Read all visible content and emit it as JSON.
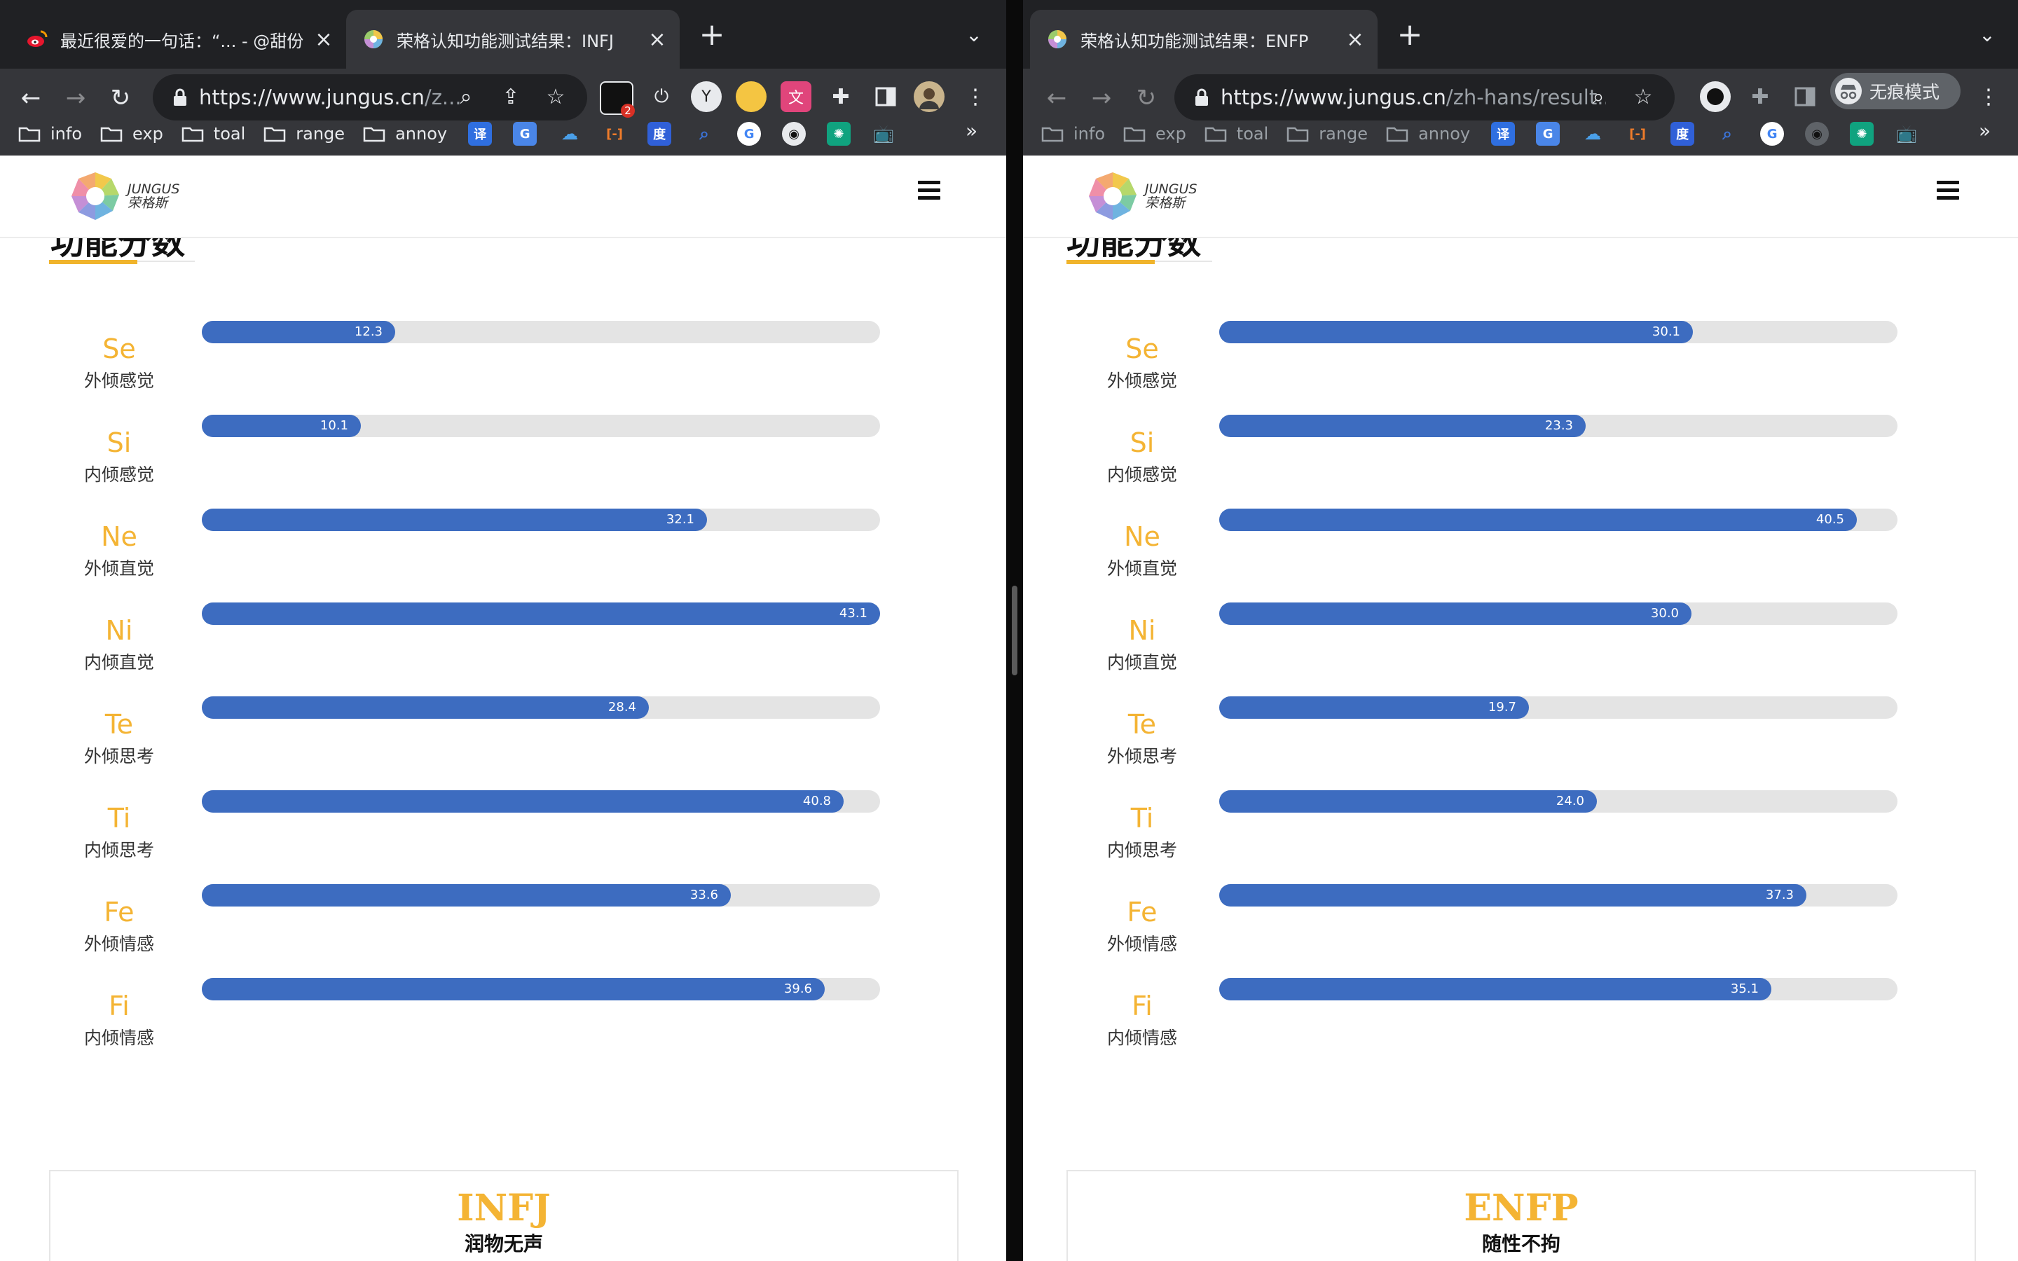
{
  "left": {
    "tabs": [
      {
        "title": "最近很爱的一句话：“... - @甜份",
        "active": false,
        "icon": "weibo-icon"
      },
      {
        "title": "荣格认知功能测试结果：INFJ",
        "active": true,
        "icon": "jungus-icon"
      }
    ],
    "url_host": "https://www.jungus.cn",
    "url_path": "/z...",
    "extension_badge": "2",
    "bookmarks": [
      "info",
      "exp",
      "toal",
      "range",
      "annoy"
    ],
    "logo": {
      "en": "JUNGUS",
      "zh": "荣格斯"
    },
    "section_title": "功能分数",
    "functions": [
      {
        "code": "Se",
        "name": "外倾感觉",
        "value": 12.3,
        "label": "12.3"
      },
      {
        "code": "Si",
        "name": "内倾感觉",
        "value": 10.1,
        "label": "10.1"
      },
      {
        "code": "Ne",
        "name": "外倾直觉",
        "value": 32.1,
        "label": "32.1"
      },
      {
        "code": "Ni",
        "name": "内倾直觉",
        "value": 43.1,
        "label": "43.1"
      },
      {
        "code": "Te",
        "name": "外倾思考",
        "value": 28.4,
        "label": "28.4"
      },
      {
        "code": "Ti",
        "name": "内倾思考",
        "value": 40.8,
        "label": "40.8"
      },
      {
        "code": "Fe",
        "name": "外倾情感",
        "value": 33.6,
        "label": "33.6"
      },
      {
        "code": "Fi",
        "name": "内倾情感",
        "value": 39.6,
        "label": "39.6"
      }
    ],
    "type_code": "INFJ",
    "type_name": "润物无声"
  },
  "right": {
    "tabs": [
      {
        "title": "荣格认知功能测试结果：ENFP",
        "active": true,
        "icon": "jungus-icon"
      }
    ],
    "url_host": "https://www.jungus.cn",
    "url_path": "/zh-hans/result...",
    "incognito_label": "无痕模式",
    "bookmarks": [
      "info",
      "exp",
      "toal",
      "range",
      "annoy"
    ],
    "logo": {
      "en": "JUNGUS",
      "zh": "荣格斯"
    },
    "section_title": "功能分数",
    "functions": [
      {
        "code": "Se",
        "name": "外倾感觉",
        "value": 30.1,
        "label": "30.1"
      },
      {
        "code": "Si",
        "name": "内倾感觉",
        "value": 23.3,
        "label": "23.3"
      },
      {
        "code": "Ne",
        "name": "外倾直觉",
        "value": 40.5,
        "label": "40.5"
      },
      {
        "code": "Ni",
        "name": "内倾直觉",
        "value": 30.0,
        "label": "30.0"
      },
      {
        "code": "Te",
        "name": "外倾思考",
        "value": 19.7,
        "label": "19.7"
      },
      {
        "code": "Ti",
        "name": "内倾思考",
        "value": 24.0,
        "label": "24.0"
      },
      {
        "code": "Fe",
        "name": "外倾情感",
        "value": 37.3,
        "label": "37.3"
      },
      {
        "code": "Fi",
        "name": "内倾情感",
        "value": 35.1,
        "label": "35.1"
      }
    ],
    "type_code": "ENFP",
    "type_name": "随性不拘"
  },
  "scale_max": 43.1,
  "colors": {
    "accent": "#f4b434",
    "bar_fill": "#3d6cc0",
    "bar_track": "#e4e4e4",
    "chrome_tabstrip": "#202124",
    "chrome_toolbar": "#35363a"
  }
}
